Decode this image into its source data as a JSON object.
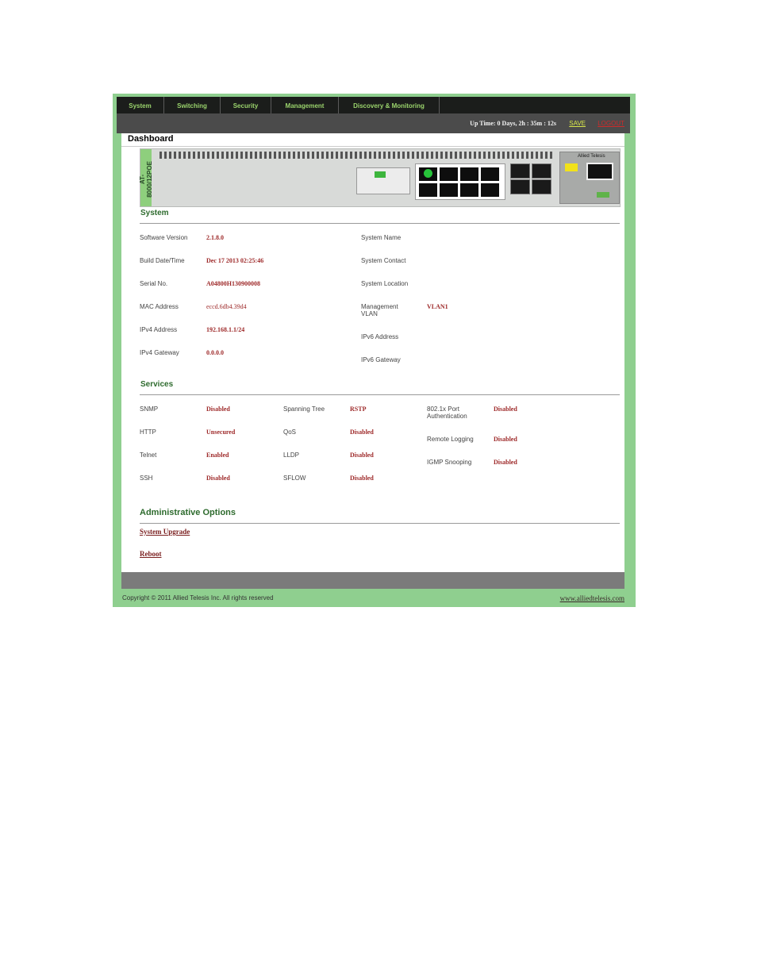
{
  "nav": {
    "tabs": [
      "System",
      "Switching",
      "Security",
      "Management",
      "Discovery & Monitoring"
    ]
  },
  "topbar": {
    "uptime": "Up Time: 0 Days, 2h : 35m : 12s",
    "save": "SAVE",
    "logout": "LOGOUT"
  },
  "page": {
    "title": "Dashboard"
  },
  "device": {
    "model": "AT-8000/12POE",
    "brand": "Allied Telesis"
  },
  "system": {
    "title": "System",
    "left": [
      {
        "label": "Software Version",
        "value": "2.1.8.0"
      },
      {
        "label": "Build Date/Time",
        "value": "Dec 17 2013 02:25:46"
      },
      {
        "label": "Serial No.",
        "value": "A04800H130900008"
      },
      {
        "label": "MAC Address",
        "value": "eccd.6db4.39d4"
      },
      {
        "label": "IPv4 Address",
        "value": "192.168.1.1/24"
      },
      {
        "label": "IPv4 Gateway",
        "value": "0.0.0.0"
      }
    ],
    "right": [
      {
        "label": "System Name",
        "value": ""
      },
      {
        "label": "System Contact",
        "value": ""
      },
      {
        "label": "System Location",
        "value": ""
      },
      {
        "label": "Management VLAN",
        "value": "VLAN1"
      },
      {
        "label": "IPv6 Address",
        "value": ""
      },
      {
        "label": "IPv6 Gateway",
        "value": ""
      }
    ]
  },
  "services": {
    "title": "Services",
    "col1": [
      {
        "label": "SNMP",
        "value": "Disabled"
      },
      {
        "label": "HTTP",
        "value": "Unsecured"
      },
      {
        "label": "Telnet",
        "value": "Enabled"
      },
      {
        "label": "SSH",
        "value": "Disabled"
      }
    ],
    "col2": [
      {
        "label": "Spanning Tree",
        "value": "RSTP"
      },
      {
        "label": "QoS",
        "value": "Disabled"
      },
      {
        "label": "LLDP",
        "value": "Disabled"
      },
      {
        "label": "SFLOW",
        "value": "Disabled"
      }
    ],
    "col3": [
      {
        "label": "802.1x Port Authentication",
        "value": "Disabled"
      },
      {
        "label": "Remote Logging",
        "value": "Disabled"
      },
      {
        "label": "IGMP Snooping",
        "value": "Disabled"
      }
    ]
  },
  "admin": {
    "title": "Administrative Options",
    "links": [
      "System Upgrade",
      "Reboot"
    ]
  },
  "footer": {
    "copyright": "Copyright © 2011 Allied Telesis Inc. All rights reserved",
    "website": "www.alliedtelesis.com"
  },
  "colors": {
    "accent": "#8fcf8f",
    "nav_text": "#9ad36c",
    "value": "#9e2a2a",
    "section_title": "#2e6b2e"
  }
}
